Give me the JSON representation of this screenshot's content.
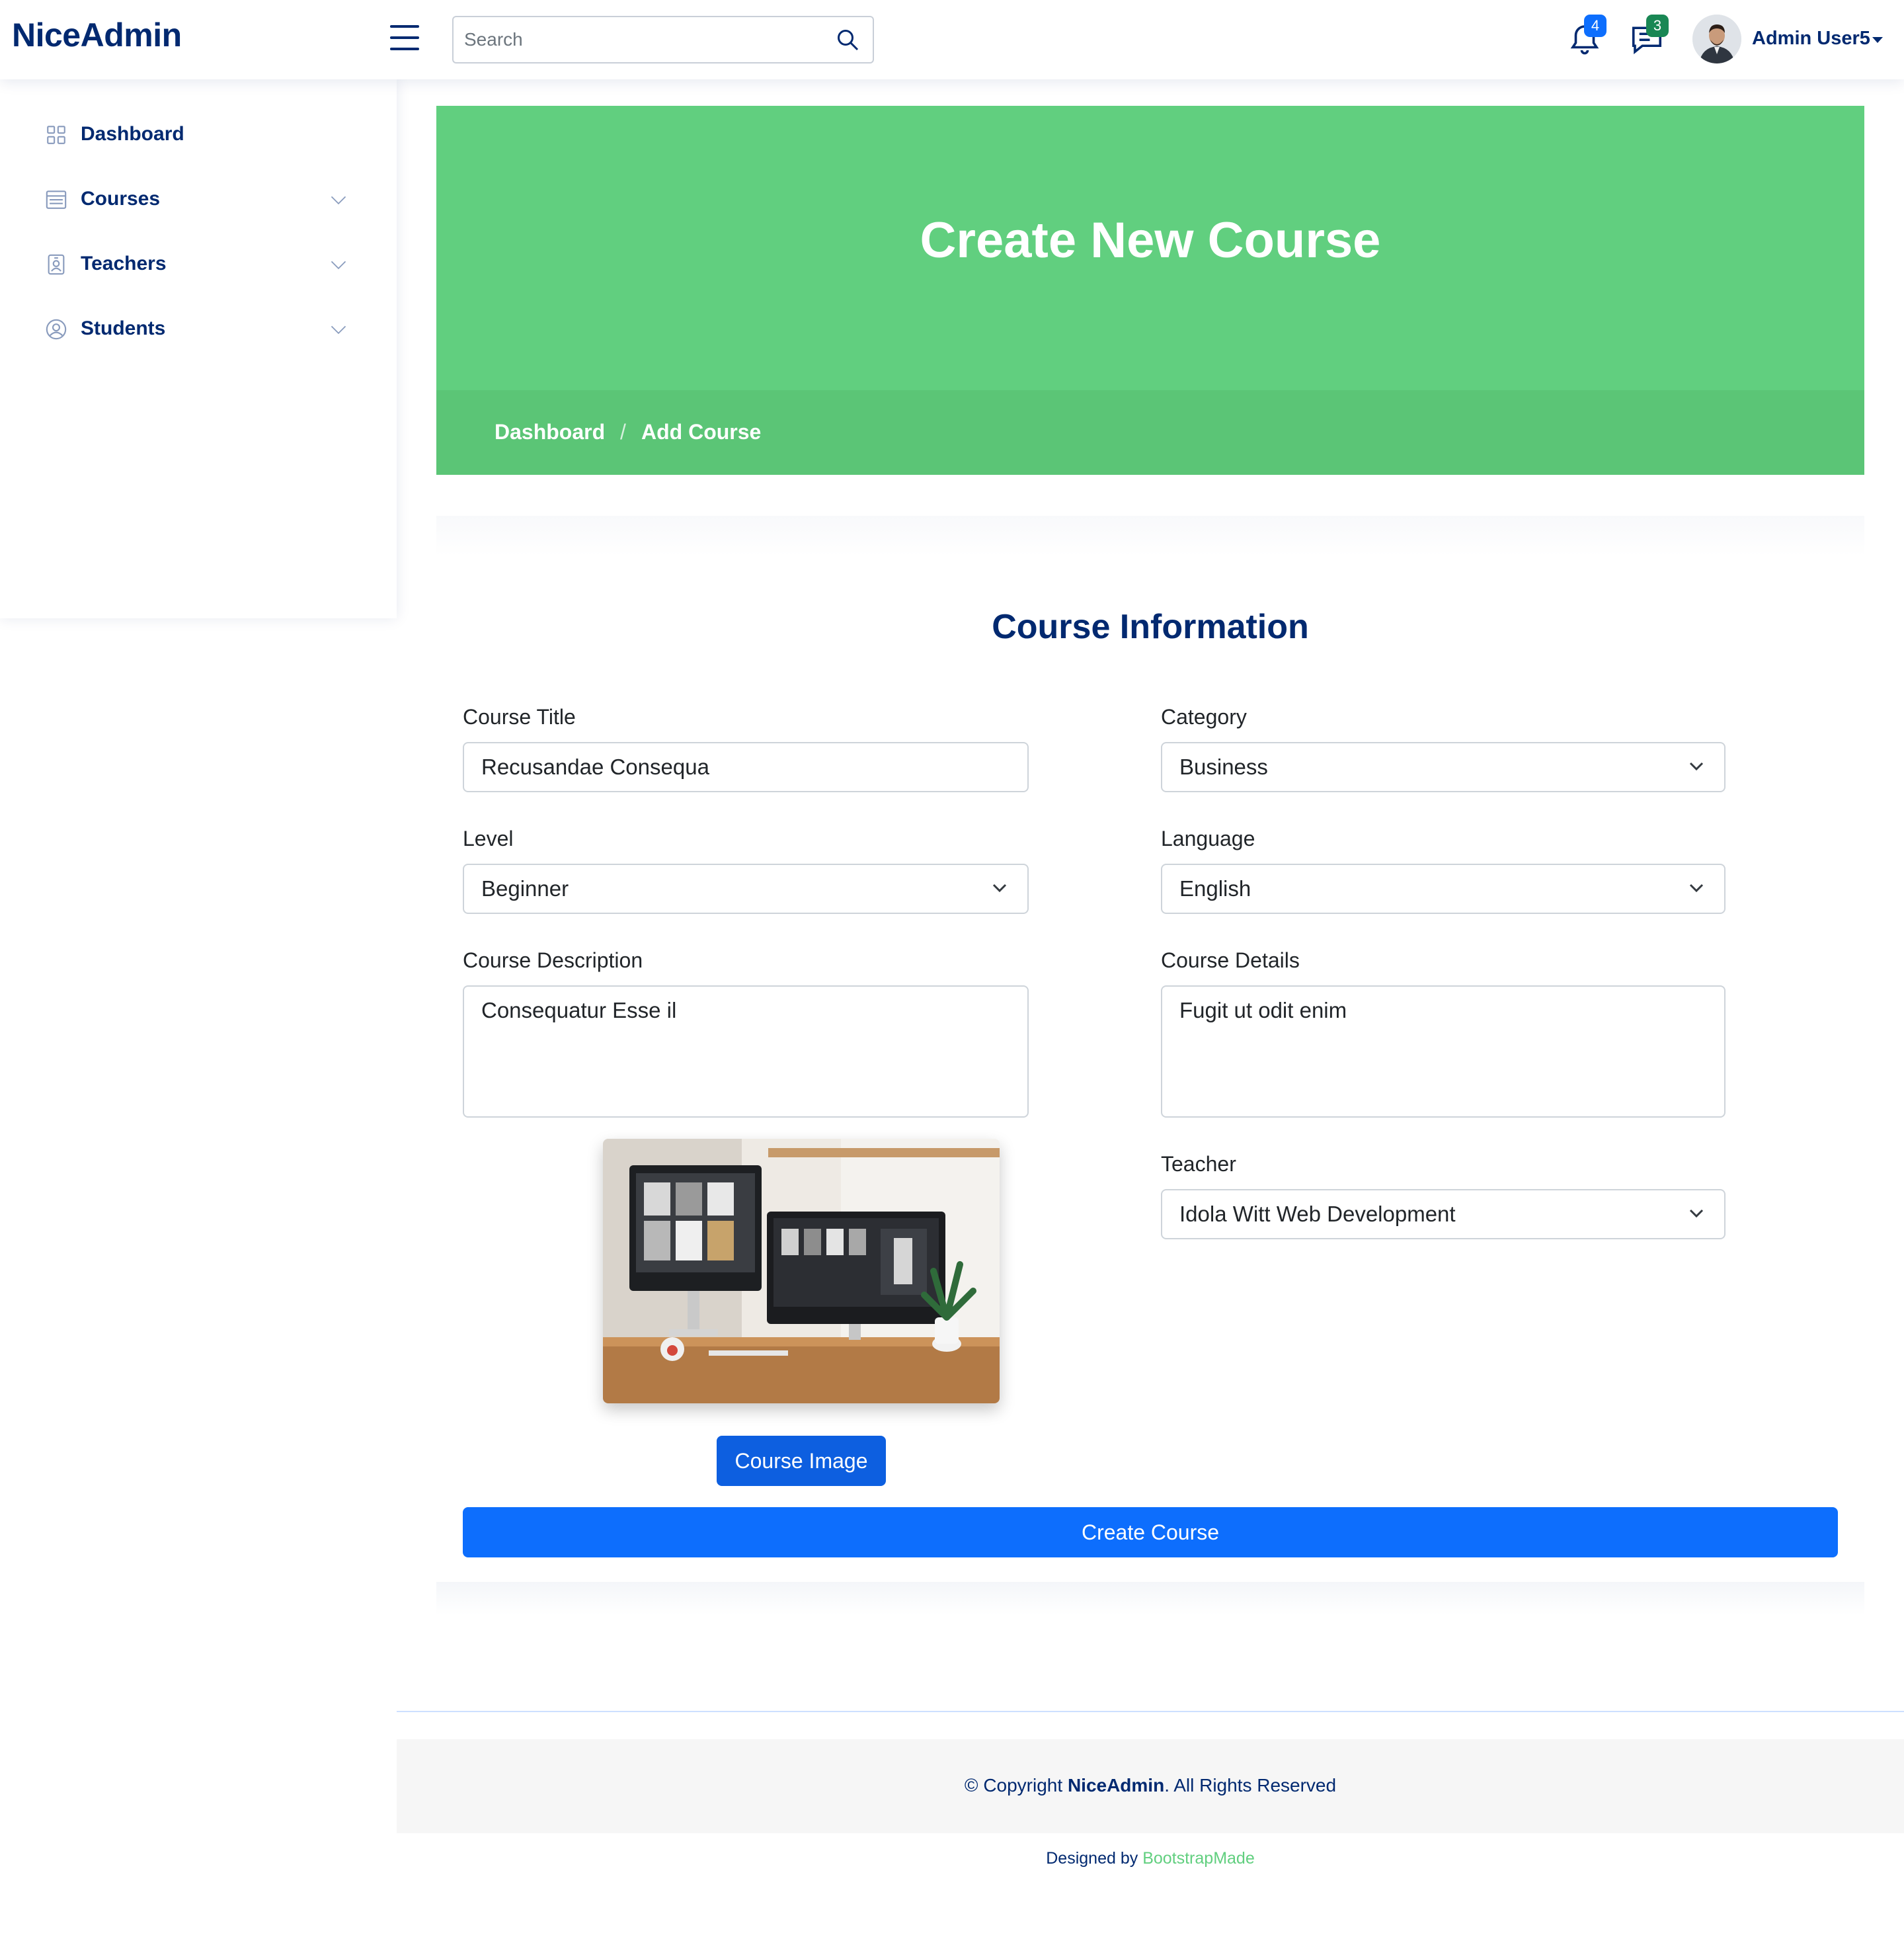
{
  "app": {
    "logo": "NiceAdmin"
  },
  "header": {
    "search": {
      "placeholder": "Search",
      "value": ""
    },
    "notifications": {
      "count": "4",
      "color": "#0d6efd"
    },
    "messages": {
      "count": "3",
      "color": "#198754"
    },
    "profile": {
      "name": "Admin User5"
    }
  },
  "sidebar": {
    "items": [
      {
        "label": "Dashboard",
        "icon": "grid-icon"
      },
      {
        "label": "Courses",
        "icon": "layout-text-sidebar-icon"
      },
      {
        "label": "Teachers",
        "icon": "person-badge-icon"
      },
      {
        "label": "Students",
        "icon": "person-circle-icon"
      }
    ]
  },
  "hero": {
    "title": "Create New Course",
    "breadcrumb": [
      "Dashboard",
      "Add Course"
    ],
    "color": "#61cf7f"
  },
  "form": {
    "heading": "Course Information",
    "fields": {
      "title": {
        "label": "Course Title",
        "value": "Recusandae Consequa"
      },
      "category": {
        "label": "Category",
        "value": "Business"
      },
      "level": {
        "label": "Level",
        "value": "Beginner"
      },
      "language": {
        "label": "Language",
        "value": "English"
      },
      "description": {
        "label": "Course Description",
        "value": "Consequatur Esse il"
      },
      "details": {
        "label": "Course Details",
        "value": "Fugit ut odit enim"
      },
      "teacher": {
        "label": "Teacher",
        "value": "Idola Witt Web Development"
      }
    },
    "image_button": "Course Image",
    "submit_button": "Create Course"
  },
  "footer": {
    "copyright_prefix": "© Copyright ",
    "copyright_brand": "NiceAdmin",
    "copyright_suffix": ". All Rights Reserved",
    "designed_by": "Designed by ",
    "designer": "BootstrapMade"
  }
}
